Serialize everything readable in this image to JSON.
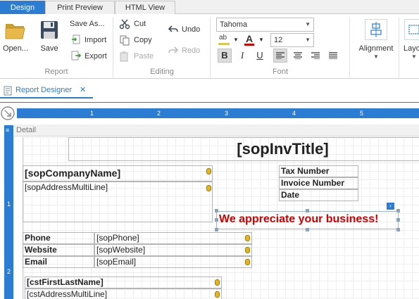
{
  "tabs": {
    "design": "Design",
    "print_preview": "Print Preview",
    "html_view": "HTML View"
  },
  "report_group": {
    "open": "Open...",
    "save": "Save",
    "save_as": "Save As...",
    "import": "Import",
    "export": "Export",
    "label": "Report"
  },
  "editing_group": {
    "cut": "Cut",
    "copy": "Copy",
    "paste": "Paste",
    "undo": "Undo",
    "redo": "Redo",
    "label": "Editing"
  },
  "font_group": {
    "font_name": "Tahoma",
    "font_size": "12",
    "label": "Font",
    "bold": "B",
    "italic": "I",
    "underline": "U",
    "highlight_glyph": "ab",
    "color_glyph": "A",
    "highlight_color": "#e8d000",
    "font_color": "#d00000"
  },
  "alignment": {
    "label": "Alignment",
    "layout_label": "Layo"
  },
  "document_tab": {
    "title": "Report Designer",
    "close": "✕"
  },
  "band": {
    "label": "Detail"
  },
  "ruler": {
    "h_ticks": [
      "1",
      "2",
      "3",
      "4",
      "5"
    ],
    "v_ticks": [
      "1",
      "2"
    ]
  },
  "report": {
    "title_field": "[sopInvTitle]",
    "company_name": "[sopCompanyName]",
    "address": "[sopAddressMultiLine]",
    "tax_number": "Tax Number",
    "invoice_number": "Invoice Number",
    "date": "Date",
    "appreciate": "We appreciate your business!",
    "appreciate_color": "#d00000",
    "phone_label": "Phone",
    "phone_field": "[sopPhone]",
    "website_label": "Website",
    "website_field": "[sopWebsite]",
    "email_label": "Email",
    "email_field": "[sopEmail]",
    "customer_name": "[cstFirstLastName]",
    "customer_address": "[cstAddressMultiLine]"
  }
}
